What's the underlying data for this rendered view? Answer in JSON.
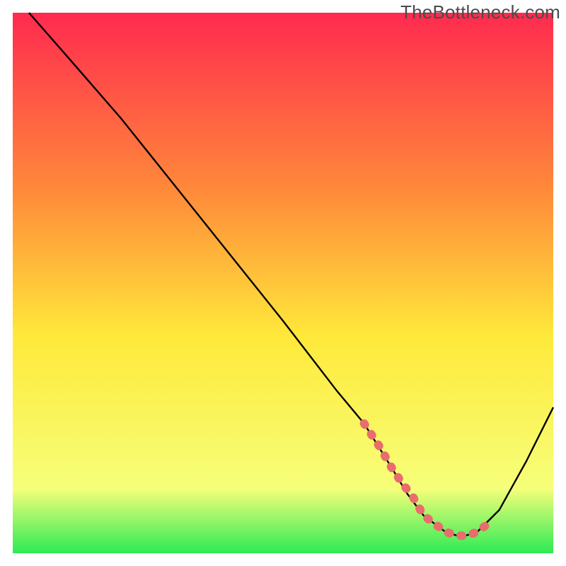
{
  "watermark": {
    "text": "TheBottleneck.com"
  },
  "chart_data": {
    "type": "line",
    "title": "",
    "xlabel": "",
    "ylabel": "",
    "xlim": [
      0,
      100
    ],
    "ylim": [
      0,
      100
    ],
    "grid": false,
    "legend": false,
    "curve": {
      "name": "bottleneck-curve",
      "x": [
        3,
        10,
        20,
        30,
        40,
        50,
        60,
        65,
        70,
        73,
        76,
        80,
        83,
        86,
        90,
        95,
        100
      ],
      "y": [
        100,
        92,
        80.5,
        68,
        55.5,
        43,
        30,
        24,
        16,
        11,
        7,
        4,
        3,
        4,
        8,
        17,
        27
      ]
    },
    "highlight_segment": {
      "name": "optimal-range",
      "color": "#e86d6d",
      "x": [
        65,
        68,
        70,
        72,
        74,
        76,
        78,
        80,
        82,
        84,
        86,
        88
      ],
      "y": [
        24,
        19.5,
        16,
        13,
        10.5,
        7,
        5.5,
        4,
        3.3,
        3.2,
        4,
        5.5
      ]
    },
    "background_gradient": {
      "top": "#ff2a4f",
      "upper": "#ff8a3a",
      "mid": "#ffe93a",
      "lower": "#f6ff7a",
      "bottom": "#2dea55"
    }
  }
}
